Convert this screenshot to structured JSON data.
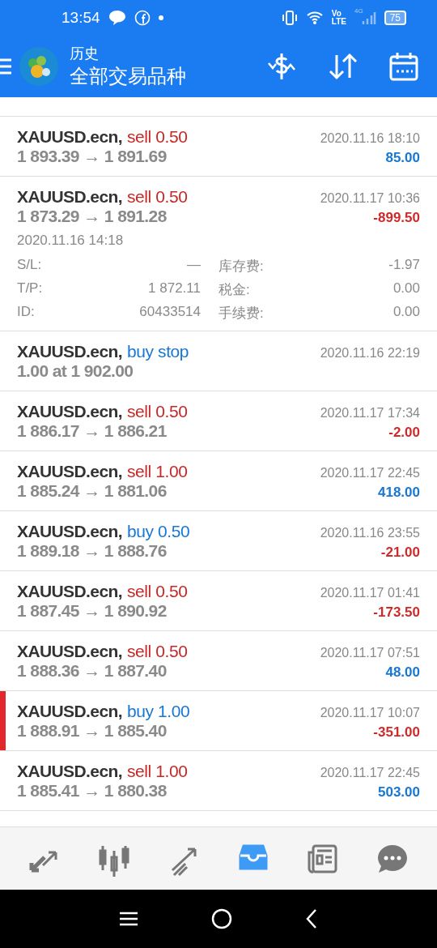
{
  "status_bar": {
    "time": "13:54",
    "battery": "75",
    "network_top": "Vo",
    "network_bottom": "LTE",
    "network_tag": "4G"
  },
  "header": {
    "title": "历史",
    "subtitle": "全部交易品种"
  },
  "trades": [
    {
      "symbol": "XAUUSD.ecn,",
      "kind": "sell",
      "order": "sell 0.50",
      "prices": "1 893.39 → 1 891.69",
      "time": "2020.11.16 18:10",
      "profit": "85.00",
      "loss": false,
      "selected": false,
      "expanded": false
    },
    {
      "symbol": "XAUUSD.ecn,",
      "kind": "sell",
      "order": "sell 0.50",
      "prices": "1 873.29 → 1 891.28",
      "time": "2020.11.17 10:36",
      "profit": "-899.50",
      "loss": true,
      "selected": false,
      "expanded": true,
      "details": {
        "open_time": "2020.11.16 14:18",
        "rows": [
          {
            "label": "S/L:",
            "value": "—",
            "label2": "库存费:",
            "value2": "-1.97"
          },
          {
            "label": "T/P:",
            "value": "1 872.11",
            "label2": "税金:",
            "value2": "0.00"
          },
          {
            "label": "ID:",
            "value": "60433514",
            "label2": "手续费:",
            "value2": "0.00"
          }
        ]
      }
    },
    {
      "symbol": "XAUUSD.ecn,",
      "kind": "buy",
      "order": "buy stop",
      "prices": "1.00 at 1 902.00",
      "time": "2020.11.16 22:19",
      "selected": false,
      "expanded": false
    },
    {
      "symbol": "XAUUSD.ecn,",
      "kind": "sell",
      "order": "sell 0.50",
      "prices": "1 886.17 → 1 886.21",
      "time": "2020.11.17 17:34",
      "profit": "-2.00",
      "loss": true,
      "selected": false,
      "expanded": false
    },
    {
      "symbol": "XAUUSD.ecn,",
      "kind": "sell",
      "order": "sell 1.00",
      "prices": "1 885.24 → 1 881.06",
      "time": "2020.11.17 22:45",
      "profit": "418.00",
      "loss": false,
      "selected": false,
      "expanded": false
    },
    {
      "symbol": "XAUUSD.ecn,",
      "kind": "buy",
      "order": "buy 0.50",
      "prices": "1 889.18 → 1 888.76",
      "time": "2020.11.16 23:55",
      "profit": "-21.00",
      "loss": true,
      "selected": false,
      "expanded": false
    },
    {
      "symbol": "XAUUSD.ecn,",
      "kind": "sell",
      "order": "sell 0.50",
      "prices": "1 887.45 → 1 890.92",
      "time": "2020.11.17 01:41",
      "profit": "-173.50",
      "loss": true,
      "selected": false,
      "expanded": false
    },
    {
      "symbol": "XAUUSD.ecn,",
      "kind": "sell",
      "order": "sell 0.50",
      "prices": "1 888.36 → 1 887.40",
      "time": "2020.11.17 07:51",
      "profit": "48.00",
      "loss": false,
      "selected": false,
      "expanded": false
    },
    {
      "symbol": "XAUUSD.ecn,",
      "kind": "buy",
      "order": "buy 1.00",
      "prices": "1 888.91 → 1 885.40",
      "time": "2020.11.17 10:07",
      "profit": "-351.00",
      "loss": true,
      "selected": true,
      "expanded": false
    },
    {
      "symbol": "XAUUSD.ecn,",
      "kind": "sell",
      "order": "sell 1.00",
      "prices": "1 885.41 → 1 880.38",
      "time": "2020.11.17 22:45",
      "profit": "503.00",
      "loss": false,
      "selected": false,
      "expanded": false
    }
  ],
  "bottom_nav": [
    {
      "kind": "quotes",
      "selected": false
    },
    {
      "kind": "chart",
      "selected": false
    },
    {
      "kind": "trade",
      "selected": false
    },
    {
      "kind": "history",
      "selected": true
    },
    {
      "kind": "news",
      "selected": false
    },
    {
      "kind": "chat",
      "selected": false
    }
  ]
}
